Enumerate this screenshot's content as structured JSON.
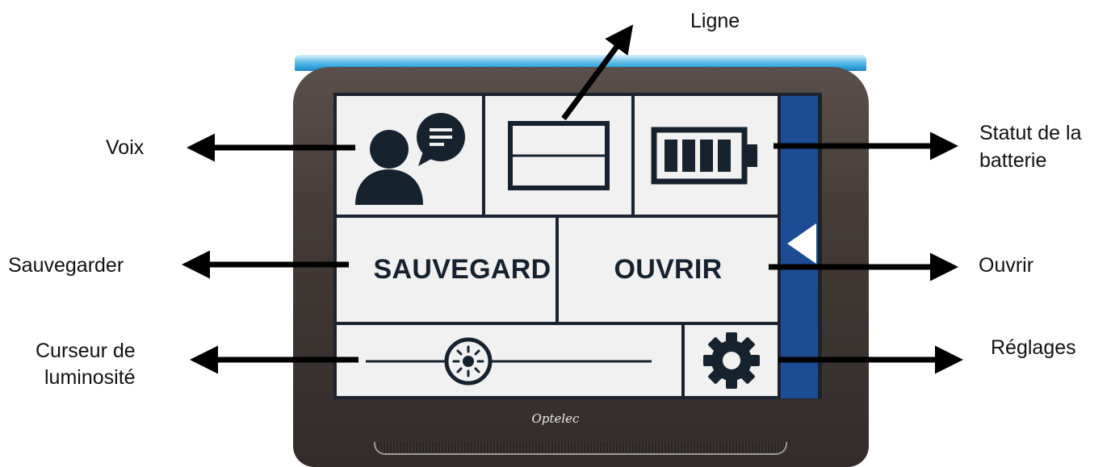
{
  "annotations": {
    "voix": "Voix",
    "ligne": "Ligne",
    "batterie_line1": "Statut de la",
    "batterie_line2": "batterie",
    "sauvegarder": "Sauvegarder",
    "ouvrir": "Ouvrir",
    "curseur_line1": "Curseur de",
    "curseur_line2": "luminosité",
    "reglages": "Réglages"
  },
  "screen": {
    "save_label": "SAUVEGARD",
    "open_label": "OUVRIR",
    "voice_icon": "person-speech-icon",
    "line_icon": "line-mode-icon",
    "battery_icon": "battery-icon",
    "brightness_icon": "sun-icon",
    "settings_icon": "gear-icon",
    "panel_icon": "triangle-left-icon",
    "battery_bars": 4
  },
  "device": {
    "brand": "Optelec"
  },
  "colors": {
    "tile_bg": "#f1f1f1",
    "icon_dark": "#17222f",
    "side_panel": "#1e4c94",
    "top_bar": "#35a8e0",
    "bezel": "#433a37"
  }
}
